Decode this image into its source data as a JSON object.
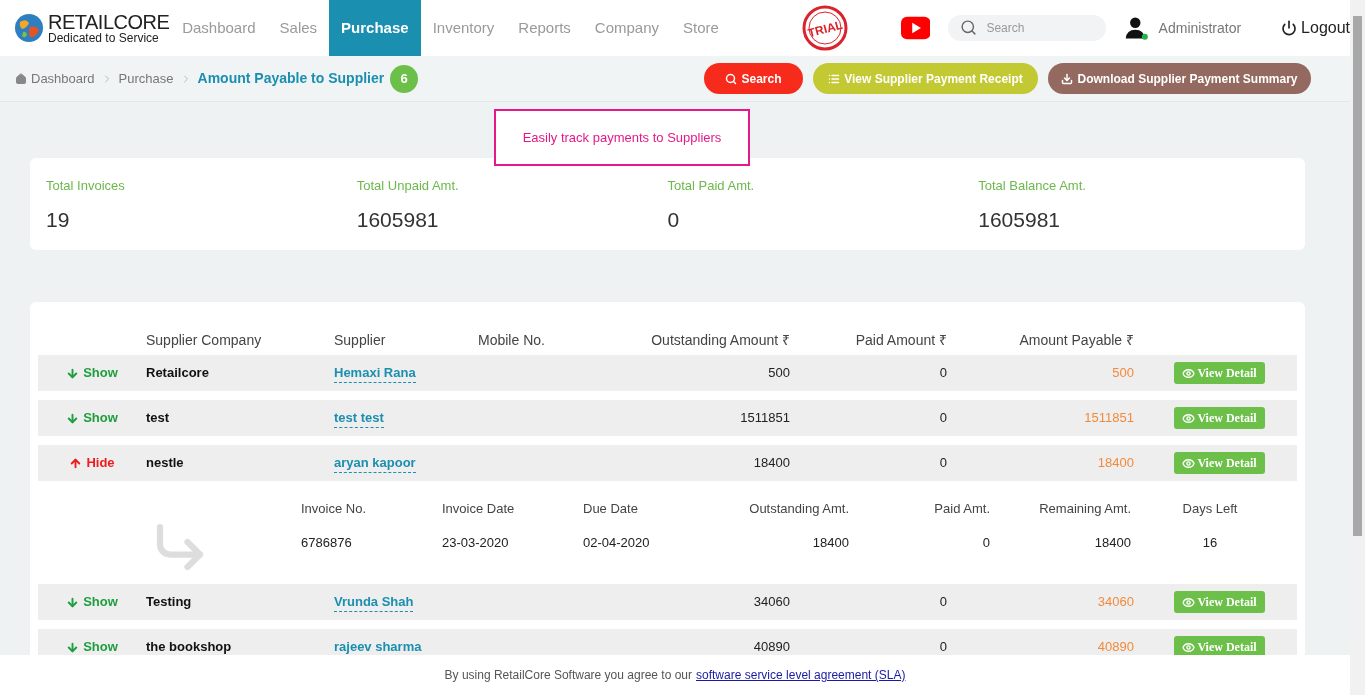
{
  "header": {
    "logo": {
      "name": "RETAILCORE",
      "tagline": "Dedicated to Service"
    },
    "nav": [
      {
        "label": "Dashboard",
        "selected": false
      },
      {
        "label": "Sales",
        "selected": false
      },
      {
        "label": "Purchase",
        "selected": true
      },
      {
        "label": "Inventory",
        "selected": false
      },
      {
        "label": "Reports",
        "selected": false
      },
      {
        "label": "Company",
        "selected": false
      },
      {
        "label": "Store",
        "selected": false
      }
    ],
    "stamp": "TRIAL",
    "search": {
      "placeholder": "Search"
    },
    "user": "Administrator",
    "logout": "Logout"
  },
  "breadcrumb": {
    "items": [
      "Dashboard",
      "Purchase"
    ],
    "current": "Amount Payable to Supplier",
    "count": "6"
  },
  "actions": [
    "Search",
    "View Supplier Payment Receipt",
    "Download Supplier Payment Summary"
  ],
  "callout": "Easily track payments to Suppliers",
  "summary": [
    {
      "label": "Total Invoices",
      "value": "19"
    },
    {
      "label": "Total Unpaid Amt.",
      "value": "1605981"
    },
    {
      "label": "Total Paid Amt.",
      "value": "0"
    },
    {
      "label": "Total Balance Amt.",
      "value": "1605981"
    }
  ],
  "table": {
    "columns": [
      "Supplier Company",
      "Supplier",
      "Mobile No.",
      "Outstanding Amount ₹",
      "Paid Amount ₹",
      "Amount Payable ₹"
    ],
    "rows": [
      {
        "toggle": "Show",
        "expanded": false,
        "company": "Retailcore",
        "supplier": "Hemaxi Rana",
        "outstanding": "500",
        "paid": "0",
        "payable": "500",
        "action": "View Detail"
      },
      {
        "toggle": "Show",
        "expanded": false,
        "company": "test",
        "supplier": "test test",
        "outstanding": "1511851",
        "paid": "0",
        "payable": "1511851",
        "action": "View Detail"
      },
      {
        "toggle": "Hide",
        "expanded": true,
        "company": "nestle",
        "supplier": "aryan kapoor",
        "outstanding": "18400",
        "paid": "0",
        "payable": "18400",
        "action": "View Detail",
        "details": {
          "columns": [
            "Invoice No.",
            "Invoice Date",
            "Due Date",
            "Outstanding Amt.",
            "Paid Amt.",
            "Remaining Amt.",
            "Days Left"
          ],
          "rows": [
            [
              "6786876",
              "23-03-2020",
              "02-04-2020",
              "18400",
              "0",
              "18400",
              "16"
            ]
          ]
        }
      },
      {
        "toggle": "Show",
        "expanded": false,
        "company": "Testing",
        "supplier": "Vrunda Shah",
        "outstanding": "34060",
        "paid": "0",
        "payable": "34060",
        "action": "View Detail"
      },
      {
        "toggle": "Show",
        "expanded": false,
        "company": "the bookshop",
        "supplier": "rajeev sharma",
        "outstanding": "40890",
        "paid": "0",
        "payable": "40890",
        "action": "View Detail"
      }
    ]
  },
  "footer": {
    "text": "By using RetailCore Software you agree to our",
    "link": "software service level agreement (SLA)"
  }
}
